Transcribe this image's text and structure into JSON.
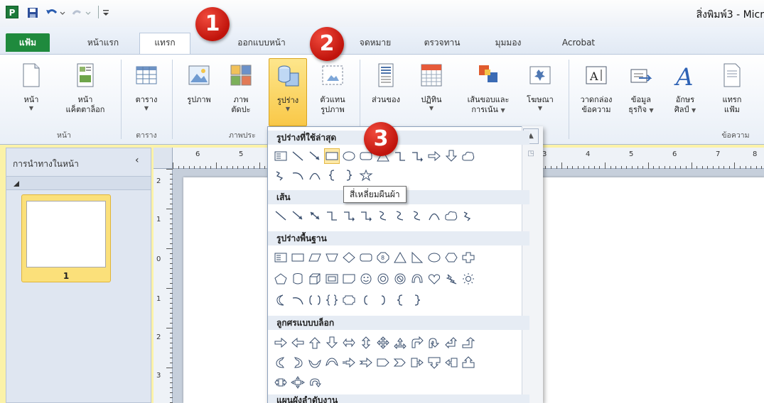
{
  "titlebar": {
    "app_icon": "P",
    "document_title": "สิ่งพิมพ์3 - Micr"
  },
  "tabs": [
    {
      "label": "แฟ้ม"
    },
    {
      "label": "หน้าแรก"
    },
    {
      "label": "แทรก"
    },
    {
      "label": "ออกแบบหน้า"
    },
    {
      "label": "จดหมาย"
    },
    {
      "label": "ตรวจทาน"
    },
    {
      "label": "มุมมอง"
    },
    {
      "label": "Acrobat"
    }
  ],
  "ribbon": {
    "page": {
      "label": "หน้า"
    },
    "catalog": {
      "label1": "หน้า",
      "label2": "แค็ตตาล็อก"
    },
    "table": {
      "label": "ตาราง"
    },
    "picture": {
      "label": "รูปภาพ"
    },
    "clipart": {
      "label1": "ภาพ",
      "label2": "ตัดปะ"
    },
    "shapes": {
      "label": "รูปร่าง"
    },
    "placeholder": {
      "label1": "ตัวแทน",
      "label2": "รูปภาพ"
    },
    "building_blocks": {
      "label1": "ส่วนของ"
    },
    "calendar": {
      "label": "ปฏิทิน"
    },
    "borders": {
      "label1": "เส้นขอบและ",
      "label2": "การเน้น"
    },
    "advert": {
      "label": "โฆษณา"
    },
    "textbox": {
      "label1": "วาดกล่อง",
      "label2": "ข้อความ"
    },
    "business_info": {
      "label1": "ข้อมูล",
      "label2": "ธุรกิจ"
    },
    "wordart": {
      "label1": "อักษร",
      "label2": "ศิลป์"
    },
    "insert_file": {
      "label1": "แทรก",
      "label2": "แฟ้ม"
    },
    "groups": {
      "pages": "หน้า",
      "tables": "ตาราง",
      "illustrations": "ภาพประ",
      "text": "ข้อความ"
    }
  },
  "callouts": [
    "1",
    "2",
    "3"
  ],
  "nav_pane": {
    "title": "การนำทางในหน้า",
    "page_number": "1"
  },
  "rulers": {
    "top": [
      "6",
      "5",
      "3",
      "4",
      "5",
      "6",
      "7",
      "8"
    ],
    "left": [
      "2",
      "1",
      "0",
      "1",
      "2",
      "3"
    ]
  },
  "gallery": {
    "recent": "รูปร่างที่ใช้ล่าสุด",
    "lines": "เส้น",
    "basic": "รูปร่างพื้นฐาน",
    "arrows": "ลูกศรแบบบล็อก",
    "flow": "แผนผังลำดับงาน",
    "tooltip": "สี่เหลี่ยมผืนผ้า"
  }
}
